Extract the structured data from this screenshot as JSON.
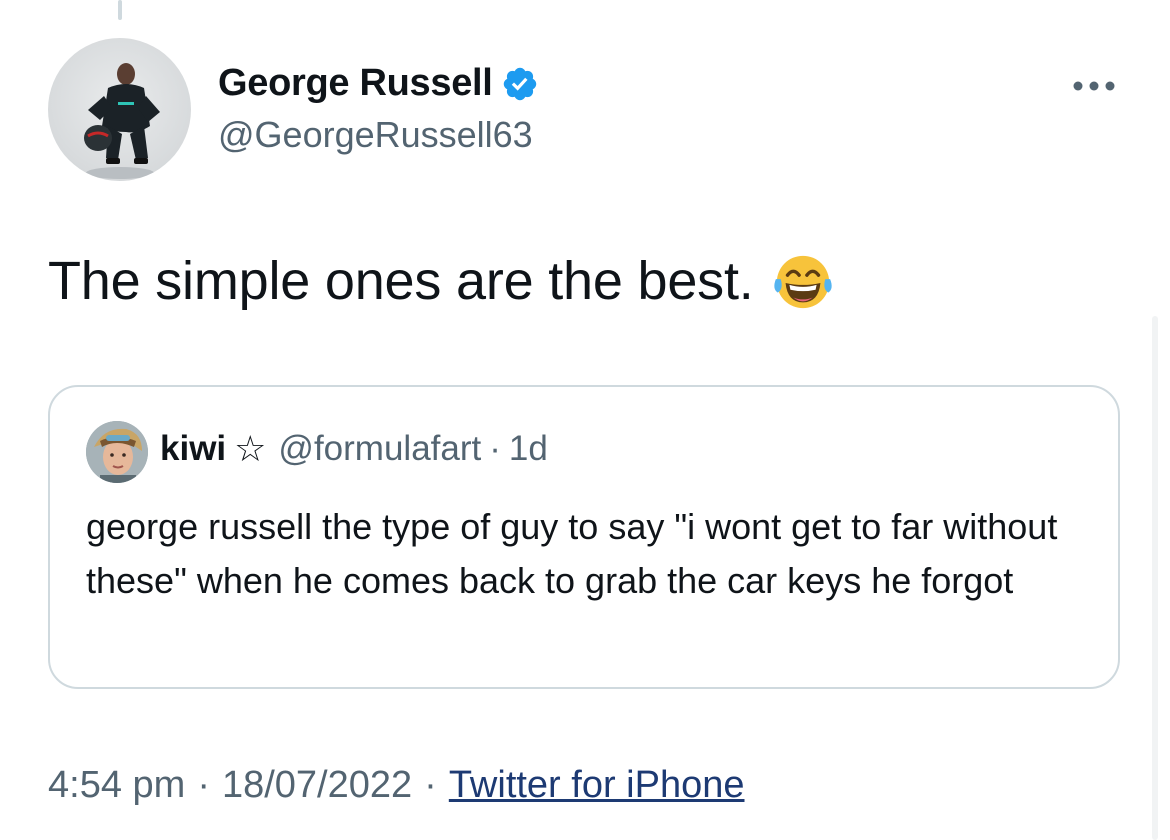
{
  "tweet": {
    "author": {
      "display_name": "George Russell",
      "handle": "@GeorgeRussell63",
      "verified_icon": "verified-badge-icon"
    },
    "text": "The simple ones are the best.",
    "emoji": "face-with-tears-of-joy",
    "more_icon": "more-options-icon"
  },
  "quote": {
    "display_name": "kiwi",
    "name_icon": "star-outline-icon",
    "handle": "@formulafart",
    "separator": "·",
    "age": "1d",
    "text": "george russell the type of guy to say \"i wont get to far without these\" when he comes back to grab the car keys he forgot"
  },
  "meta": {
    "time": "4:54 pm",
    "separator": "·",
    "date": "18/07/2022",
    "source": "Twitter for iPhone"
  },
  "colors": {
    "text_primary": "#0f1419",
    "text_secondary": "#536471",
    "verified_blue": "#1d9bf0",
    "border": "#cfd9de",
    "link": "#1d3a73"
  }
}
